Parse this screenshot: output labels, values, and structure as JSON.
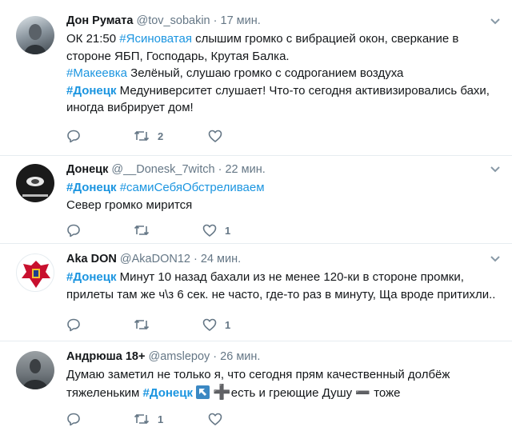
{
  "tweets": [
    {
      "name": "Дон Румата",
      "handle": "@tov_sobakin",
      "sep": "·",
      "time": "17 мин.",
      "lines": [
        {
          "t1": "ОК 21:50 ",
          "tag": "#Ясиноватая",
          "t2": " слышим громко с вибрацией окон, сверкание в"
        },
        {
          "t1": "стороне ЯБП, Господарь, Крутая Балка."
        },
        {
          "tag": "#Макеевка",
          "t2": " Зелёный, слушаю громко с содроганием воздуха"
        },
        {
          "tagb": "#Донецк",
          "t2": " Медуниверситет слушает! Что-то сегодня активизировались бахи,"
        },
        {
          "t1": "иногда вибрирует дом!"
        }
      ],
      "counts": {
        "reply": "",
        "retweet": "2",
        "like": ""
      }
    },
    {
      "name": "Донецк",
      "handle": "@__Donesk_7witch",
      "sep": "·",
      "time": "22 мин.",
      "lines": [
        {
          "tagb": "#Донецк",
          "t2": " ",
          "tag2": "#самиСебяОбстреливаем"
        },
        {
          "t1": "Север громко мирится"
        }
      ],
      "counts": {
        "reply": "",
        "retweet": "",
        "like": "1"
      }
    },
    {
      "name": "Aka DON",
      "handle": "@AkaDON12",
      "sep": "·",
      "time": "24 мин.",
      "lines": [
        {
          "tagb": "#Донецк",
          "t2": " Минут 10 назад бахали из не менее 120-ки в стороне промки,"
        },
        {
          "t1": "прилеты там же ч\\з 6 сек. не часто, где-то раз в минуту, Ща вроде притихли.."
        }
      ],
      "counts": {
        "reply": "",
        "retweet": "",
        "like": "1"
      }
    },
    {
      "name": "Андрюша 18+",
      "handle": "@amslepoy",
      "sep": "·",
      "time": "26 мин.",
      "lines": [
        {
          "t1": "Думаю заметил не только я, что сегодня прям качественный долбёж"
        },
        {
          "t1": "тяжеленьким ",
          "tagb": "#Донецк",
          "t2": " ",
          "special": true
        }
      ],
      "special_text": {
        "plus": "➕",
        "after_plus": "есть и греющие  Душу ",
        "minus": "➖",
        "after_minus": " тоже"
      },
      "counts": {
        "reply": "",
        "retweet": "1",
        "like": ""
      }
    }
  ],
  "colors": {
    "link": "#1b95e0",
    "muted": "#657786",
    "text": "#14171a",
    "divider": "#e6ecf0"
  },
  "icons": [
    "reply-icon",
    "retweet-icon",
    "like-icon",
    "chevron-down-icon",
    "arrow-up-left-emoji"
  ]
}
